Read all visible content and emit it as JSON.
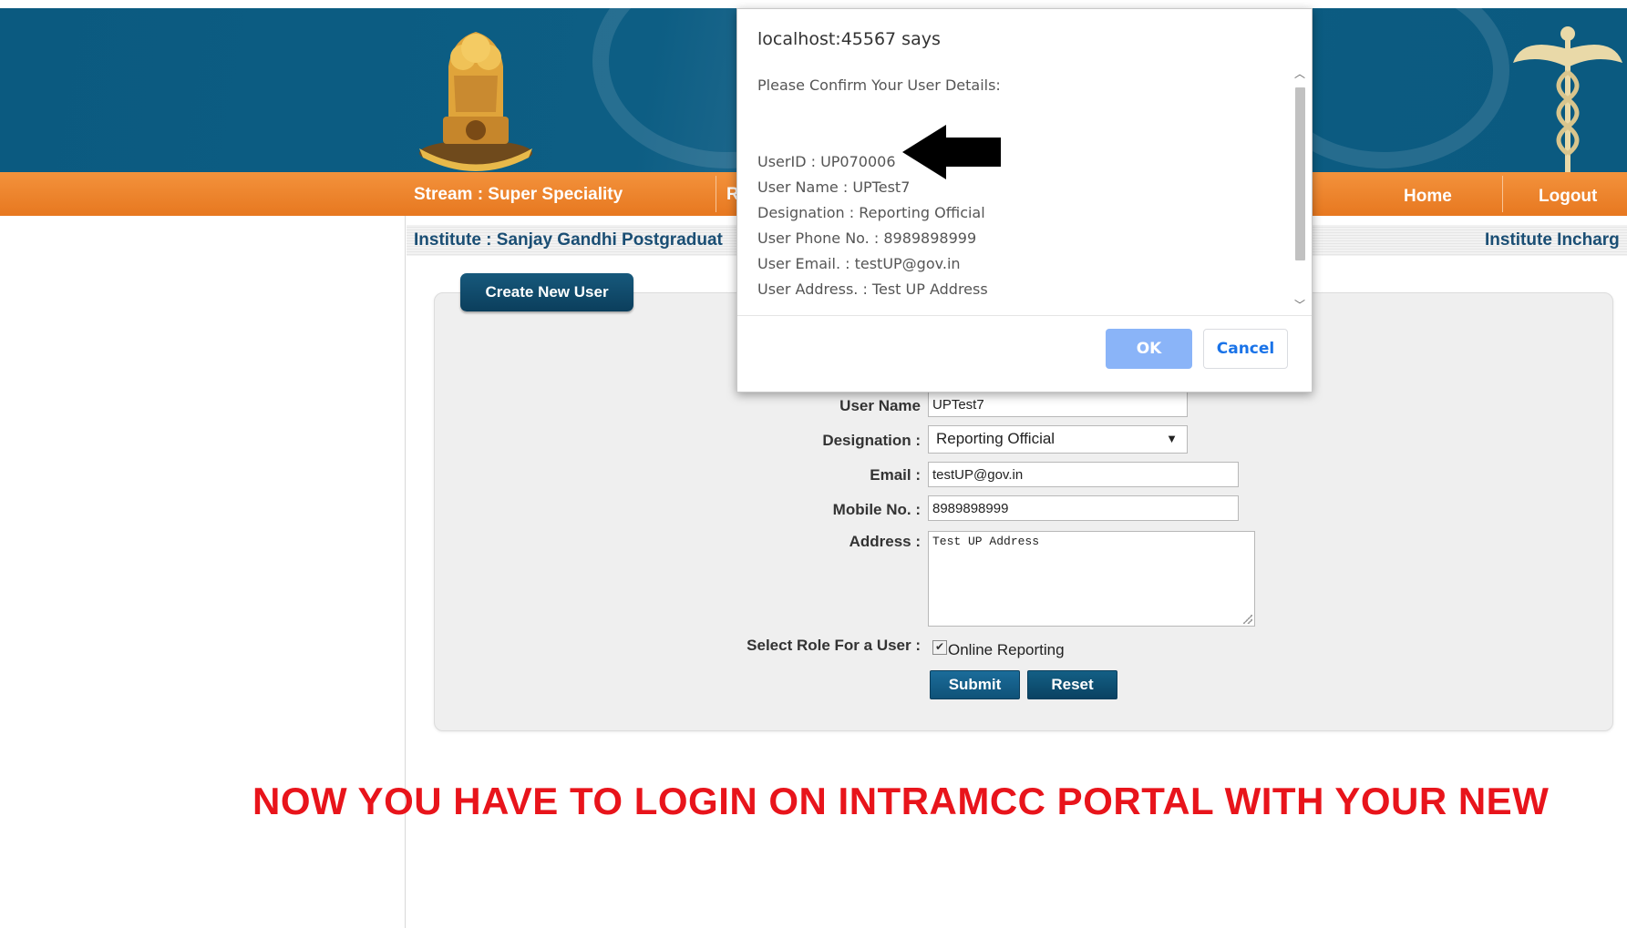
{
  "header": {
    "emblem_icon": "state-emblem-icon",
    "caduceus_icon": "caduceus-icon"
  },
  "nav": {
    "stream": "Stream : Super Speciality",
    "partial_item": "R",
    "home": "Home",
    "logout": "Logout"
  },
  "institute_bar": {
    "institute": "Institute : Sanjay Gandhi Postgraduat",
    "paren": ")",
    "incharge": "Institute Incharg"
  },
  "create_button": "Create New User",
  "form": {
    "username_label": "User Name",
    "username_value": "UPTest7",
    "designation_label": "Designation :",
    "designation_value": "Reporting Official",
    "email_label": "Email :",
    "email_value": "testUP@gov.in",
    "mobile_label": "Mobile No. :",
    "mobile_value": "8989898999",
    "address_label": "Address :",
    "address_value": "Test UP Address",
    "role_label": "Select Role For a User :",
    "role_option": "Online Reporting",
    "role_checked": true,
    "submit": "Submit",
    "reset": "Reset"
  },
  "banner": "NOW YOU HAVE TO LOGIN ON INTRAMCC PORTAL WITH YOUR NEW",
  "dialog": {
    "title": "localhost:45567 says",
    "intro": "Please Confirm Your User Details:",
    "userid": "UserID : UP070006",
    "username": "User Name : UPTest7",
    "designation": "Designation : Reporting Official",
    "phone": "User Phone No. : 8989898999",
    "email": "User Email. : testUP@gov.in",
    "address": "User Address. : Test UP Address",
    "ok": "OK",
    "cancel": "Cancel"
  },
  "colors": {
    "header_blue": "#0b5a80",
    "nav_orange": "#ec8127",
    "button_navy": "#0b3e5c",
    "banner_red": "#e8141b",
    "ok_blue": "#8ab4f8"
  }
}
